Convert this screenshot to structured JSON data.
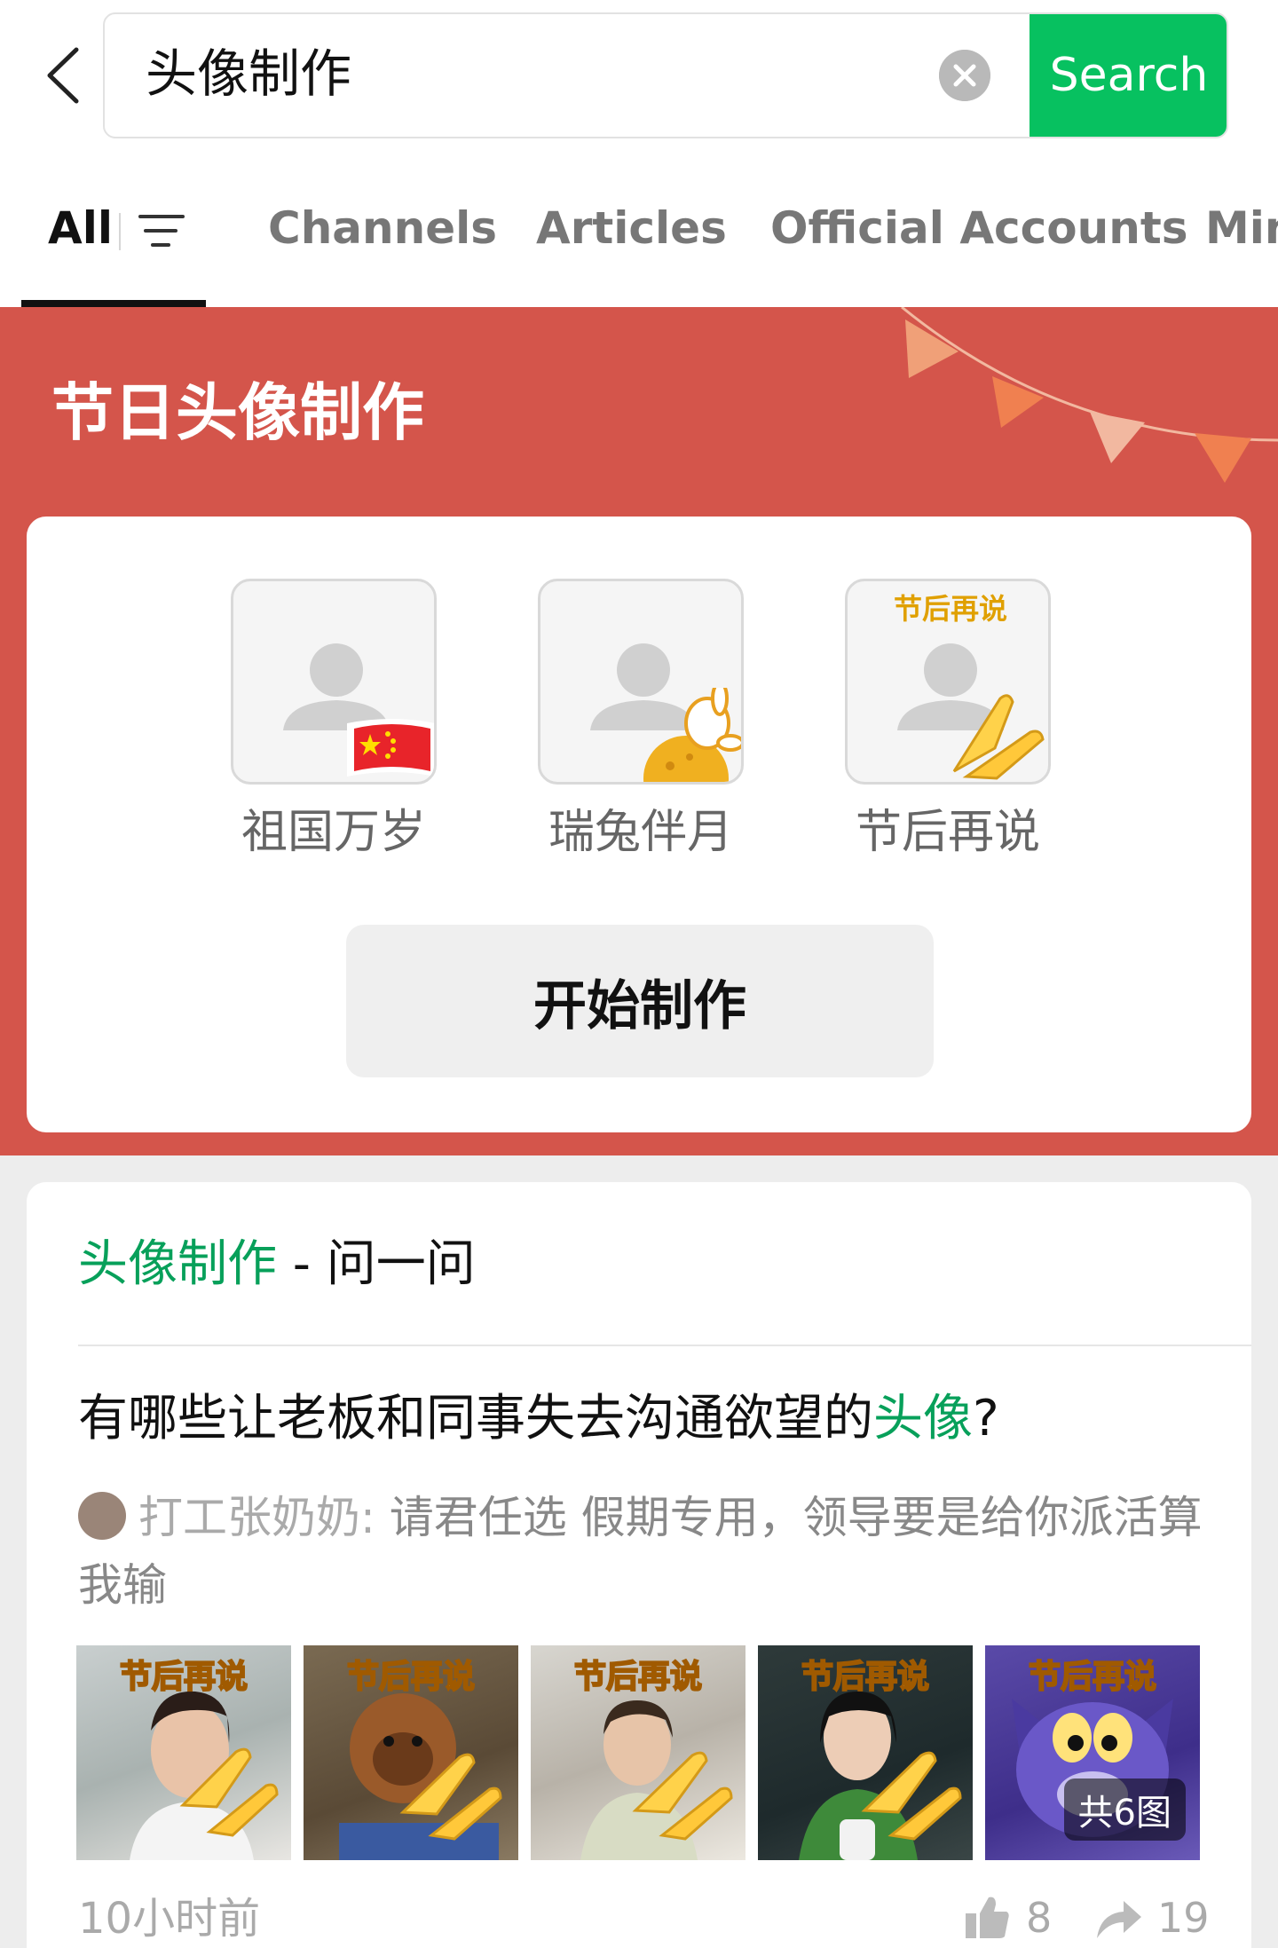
{
  "search": {
    "query": "头像制作",
    "button_label": "Search"
  },
  "tabs": [
    {
      "label": "All",
      "active": true
    },
    {
      "label": "Channels"
    },
    {
      "label": "Articles"
    },
    {
      "label": "Official Accounts"
    },
    {
      "label": "Min"
    }
  ],
  "banner": {
    "title": "节日头像制作",
    "background_color": "#d4554b",
    "options": [
      {
        "label": "祖国万岁",
        "badge": "china-flag-icon"
      },
      {
        "label": "瑞兔伴月",
        "badge": "rabbit-moon-icon"
      },
      {
        "label": "节后再说",
        "badge": "clasped-hands-icon",
        "caption": "节后再说"
      }
    ],
    "start_button": "开始制作"
  },
  "qa": {
    "header_keyword": "头像制作",
    "header_suffix": " - 问一问",
    "question_main": "有哪些让老板和同事失去沟通欲望的",
    "question_keyword": "头像",
    "question_end": "?",
    "answer_user": "打工张奶奶:",
    "answer_text": " 请君任选 假期专用，领导要是给你派活算我输",
    "thumbnails": [
      {
        "caption": "节后再说",
        "subject": "woman-photo"
      },
      {
        "caption": "节后再说",
        "subject": "monkey-photo"
      },
      {
        "caption": "节后再说",
        "subject": "girl-photo"
      },
      {
        "caption": "节后再说",
        "subject": "woman-green-photo"
      },
      {
        "caption": "节后再说",
        "subject": "cartoon-cat"
      }
    ],
    "thumb_count_label": "共6图",
    "time": "10小时前",
    "likes": "8",
    "shares": "19",
    "accent_color": "#07a05a"
  }
}
